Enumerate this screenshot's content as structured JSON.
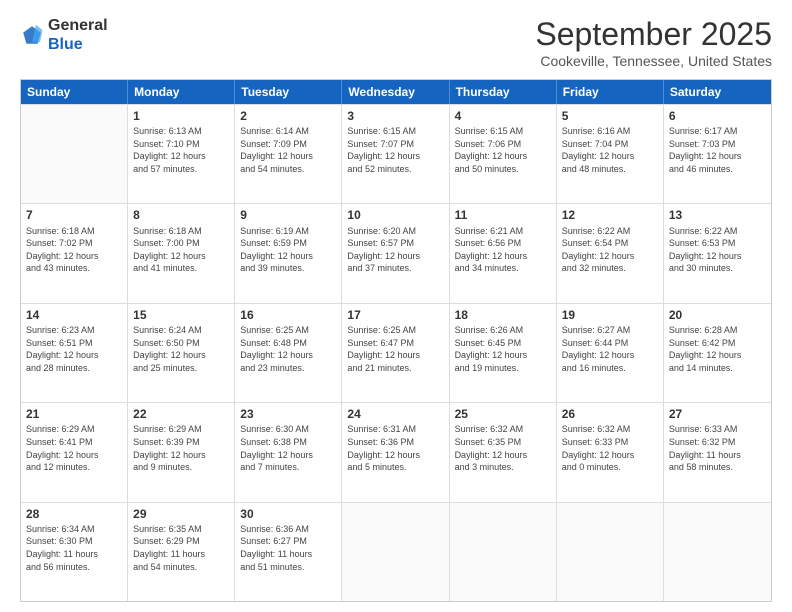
{
  "header": {
    "logo_line1": "General",
    "logo_line2": "Blue",
    "title": "September 2025",
    "subtitle": "Cookeville, Tennessee, United States"
  },
  "days_of_week": [
    "Sunday",
    "Monday",
    "Tuesday",
    "Wednesday",
    "Thursday",
    "Friday",
    "Saturday"
  ],
  "weeks": [
    [
      {
        "day": "",
        "info": ""
      },
      {
        "day": "1",
        "info": "Sunrise: 6:13 AM\nSunset: 7:10 PM\nDaylight: 12 hours\nand 57 minutes."
      },
      {
        "day": "2",
        "info": "Sunrise: 6:14 AM\nSunset: 7:09 PM\nDaylight: 12 hours\nand 54 minutes."
      },
      {
        "day": "3",
        "info": "Sunrise: 6:15 AM\nSunset: 7:07 PM\nDaylight: 12 hours\nand 52 minutes."
      },
      {
        "day": "4",
        "info": "Sunrise: 6:15 AM\nSunset: 7:06 PM\nDaylight: 12 hours\nand 50 minutes."
      },
      {
        "day": "5",
        "info": "Sunrise: 6:16 AM\nSunset: 7:04 PM\nDaylight: 12 hours\nand 48 minutes."
      },
      {
        "day": "6",
        "info": "Sunrise: 6:17 AM\nSunset: 7:03 PM\nDaylight: 12 hours\nand 46 minutes."
      }
    ],
    [
      {
        "day": "7",
        "info": "Sunrise: 6:18 AM\nSunset: 7:02 PM\nDaylight: 12 hours\nand 43 minutes."
      },
      {
        "day": "8",
        "info": "Sunrise: 6:18 AM\nSunset: 7:00 PM\nDaylight: 12 hours\nand 41 minutes."
      },
      {
        "day": "9",
        "info": "Sunrise: 6:19 AM\nSunset: 6:59 PM\nDaylight: 12 hours\nand 39 minutes."
      },
      {
        "day": "10",
        "info": "Sunrise: 6:20 AM\nSunset: 6:57 PM\nDaylight: 12 hours\nand 37 minutes."
      },
      {
        "day": "11",
        "info": "Sunrise: 6:21 AM\nSunset: 6:56 PM\nDaylight: 12 hours\nand 34 minutes."
      },
      {
        "day": "12",
        "info": "Sunrise: 6:22 AM\nSunset: 6:54 PM\nDaylight: 12 hours\nand 32 minutes."
      },
      {
        "day": "13",
        "info": "Sunrise: 6:22 AM\nSunset: 6:53 PM\nDaylight: 12 hours\nand 30 minutes."
      }
    ],
    [
      {
        "day": "14",
        "info": "Sunrise: 6:23 AM\nSunset: 6:51 PM\nDaylight: 12 hours\nand 28 minutes."
      },
      {
        "day": "15",
        "info": "Sunrise: 6:24 AM\nSunset: 6:50 PM\nDaylight: 12 hours\nand 25 minutes."
      },
      {
        "day": "16",
        "info": "Sunrise: 6:25 AM\nSunset: 6:48 PM\nDaylight: 12 hours\nand 23 minutes."
      },
      {
        "day": "17",
        "info": "Sunrise: 6:25 AM\nSunset: 6:47 PM\nDaylight: 12 hours\nand 21 minutes."
      },
      {
        "day": "18",
        "info": "Sunrise: 6:26 AM\nSunset: 6:45 PM\nDaylight: 12 hours\nand 19 minutes."
      },
      {
        "day": "19",
        "info": "Sunrise: 6:27 AM\nSunset: 6:44 PM\nDaylight: 12 hours\nand 16 minutes."
      },
      {
        "day": "20",
        "info": "Sunrise: 6:28 AM\nSunset: 6:42 PM\nDaylight: 12 hours\nand 14 minutes."
      }
    ],
    [
      {
        "day": "21",
        "info": "Sunrise: 6:29 AM\nSunset: 6:41 PM\nDaylight: 12 hours\nand 12 minutes."
      },
      {
        "day": "22",
        "info": "Sunrise: 6:29 AM\nSunset: 6:39 PM\nDaylight: 12 hours\nand 9 minutes."
      },
      {
        "day": "23",
        "info": "Sunrise: 6:30 AM\nSunset: 6:38 PM\nDaylight: 12 hours\nand 7 minutes."
      },
      {
        "day": "24",
        "info": "Sunrise: 6:31 AM\nSunset: 6:36 PM\nDaylight: 12 hours\nand 5 minutes."
      },
      {
        "day": "25",
        "info": "Sunrise: 6:32 AM\nSunset: 6:35 PM\nDaylight: 12 hours\nand 3 minutes."
      },
      {
        "day": "26",
        "info": "Sunrise: 6:32 AM\nSunset: 6:33 PM\nDaylight: 12 hours\nand 0 minutes."
      },
      {
        "day": "27",
        "info": "Sunrise: 6:33 AM\nSunset: 6:32 PM\nDaylight: 11 hours\nand 58 minutes."
      }
    ],
    [
      {
        "day": "28",
        "info": "Sunrise: 6:34 AM\nSunset: 6:30 PM\nDaylight: 11 hours\nand 56 minutes."
      },
      {
        "day": "29",
        "info": "Sunrise: 6:35 AM\nSunset: 6:29 PM\nDaylight: 11 hours\nand 54 minutes."
      },
      {
        "day": "30",
        "info": "Sunrise: 6:36 AM\nSunset: 6:27 PM\nDaylight: 11 hours\nand 51 minutes."
      },
      {
        "day": "",
        "info": ""
      },
      {
        "day": "",
        "info": ""
      },
      {
        "day": "",
        "info": ""
      },
      {
        "day": "",
        "info": ""
      }
    ]
  ]
}
